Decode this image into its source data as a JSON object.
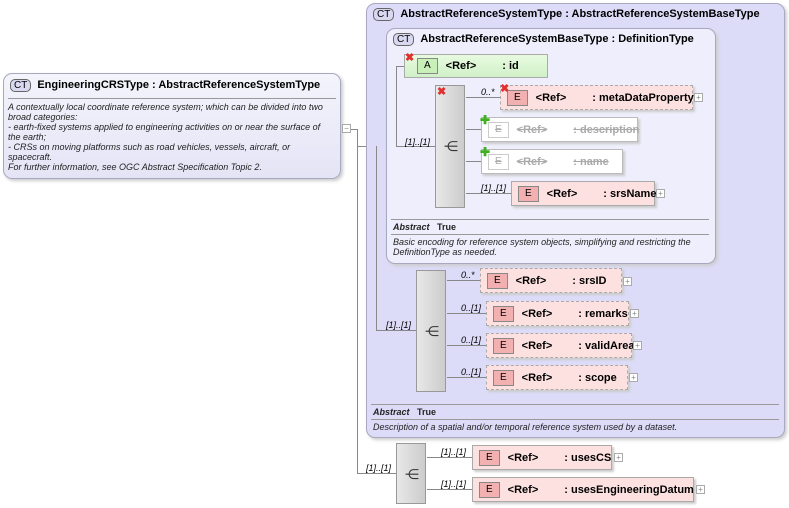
{
  "root": {
    "badge": "CT",
    "title": "EngineeringCRSType : AbstractReferenceSystemType",
    "description": [
      "A contextually local coordinate reference system; which can be divided into two",
      "broad categories:",
      "- earth-fixed systems applied to engineering activities on or near the surface of",
      "the earth;",
      "- CRSs on moving platforms such as road vehicles, vessels, aircraft, or",
      "spacecraft.",
      "For further information, see OGC Abstract Specification Topic 2."
    ]
  },
  "outer": {
    "badge": "CT",
    "title": "AbstractReferenceSystemType : AbstractReferenceSystemBaseType",
    "abstract_label": "Abstract",
    "abstract_value": "True",
    "description": "Description of a spatial and/or temporal reference system used by a dataset."
  },
  "inner": {
    "badge": "CT",
    "title": "AbstractReferenceSystemBaseType : DefinitionType",
    "abstract_label": "Abstract",
    "abstract_value": "True",
    "description": [
      "Basic encoding for reference system objects, simplifying and restricting the",
      "DefinitionType as needed."
    ]
  },
  "attribute": {
    "badge": "A",
    "ref": "<Ref>",
    "name": ": id"
  },
  "seq1_card": "[1]..[1]",
  "seq2_card": "[1]..[1]",
  "seq3_card": "[1]..[1]",
  "elements": [
    {
      "badge": "E",
      "ref": "<Ref>",
      "name": ": metaDataProperty",
      "card": "0..*"
    },
    {
      "badge": "E",
      "ref": "<Ref>",
      "name": ": description",
      "card": ""
    },
    {
      "badge": "E",
      "ref": "<Ref>",
      "name": ": name",
      "card": ""
    },
    {
      "badge": "E",
      "ref": "<Ref>",
      "name": ": srsName",
      "card": "[1]..[1]"
    },
    {
      "badge": "E",
      "ref": "<Ref>",
      "name": ": srsID",
      "card": "0..*"
    },
    {
      "badge": "E",
      "ref": "<Ref>",
      "name": ": remarks",
      "card": "0..[1]"
    },
    {
      "badge": "E",
      "ref": "<Ref>",
      "name": ": validArea",
      "card": "0..[1]"
    },
    {
      "badge": "E",
      "ref": "<Ref>",
      "name": ": scope",
      "card": "0..[1]"
    },
    {
      "badge": "E",
      "ref": "<Ref>",
      "name": ": usesCS",
      "card": "[1]..[1]"
    },
    {
      "badge": "E",
      "ref": "<Ref>",
      "name": ": usesEngineeringDatum",
      "card": "[1]..[1]"
    }
  ],
  "colors": {
    "element": "#fde0e0",
    "attribute": "#d8f4d0",
    "complex": "#dcdcf8"
  }
}
